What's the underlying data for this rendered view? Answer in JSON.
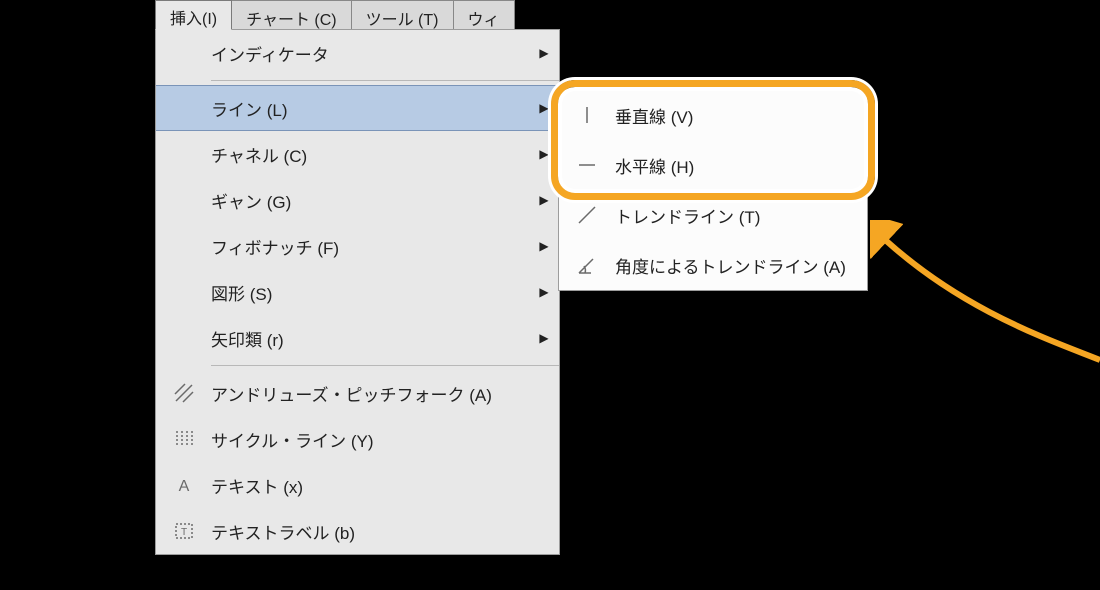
{
  "menubar": {
    "items": [
      {
        "label": "挿入(I)",
        "active": true
      },
      {
        "label": "チャート (C)",
        "active": false
      },
      {
        "label": "ツール (T)",
        "active": false
      },
      {
        "label": "ウィ",
        "active": false
      }
    ]
  },
  "dropdown": {
    "items": [
      {
        "label": "インディケータ",
        "icon": null,
        "submenu": true,
        "highlight": false
      },
      {
        "sep": true
      },
      {
        "label": "ライン (L)",
        "icon": null,
        "submenu": true,
        "highlight": true
      },
      {
        "label": "チャネル (C)",
        "icon": null,
        "submenu": true,
        "highlight": false
      },
      {
        "label": "ギャン (G)",
        "icon": null,
        "submenu": true,
        "highlight": false
      },
      {
        "label": "フィボナッチ (F)",
        "icon": null,
        "submenu": true,
        "highlight": false
      },
      {
        "label": "図形 (S)",
        "icon": null,
        "submenu": true,
        "highlight": false
      },
      {
        "label": "矢印類 (r)",
        "icon": null,
        "submenu": true,
        "highlight": false
      },
      {
        "sep": true
      },
      {
        "label": "アンドリューズ・ピッチフォーク (A)",
        "icon": "pitchfork-icon",
        "submenu": false,
        "highlight": false
      },
      {
        "label": "サイクル・ライン (Y)",
        "icon": "cycle-lines-icon",
        "submenu": false,
        "highlight": false
      },
      {
        "label": "テキスト (x)",
        "icon": "text-icon",
        "submenu": false,
        "highlight": false
      },
      {
        "label": "テキストラベル (b)",
        "icon": "text-label-icon",
        "submenu": false,
        "highlight": false
      }
    ]
  },
  "submenu": {
    "items": [
      {
        "label": "垂直線 (V)",
        "icon": "vertical-line-icon"
      },
      {
        "label": "水平線 (H)",
        "icon": "horizontal-line-icon"
      },
      {
        "label": "トレンドライン (T)",
        "icon": "trendline-icon"
      },
      {
        "label": "角度によるトレンドライン (A)",
        "icon": "angle-trendline-icon"
      }
    ]
  },
  "callout": {
    "color": "#f5a623"
  }
}
